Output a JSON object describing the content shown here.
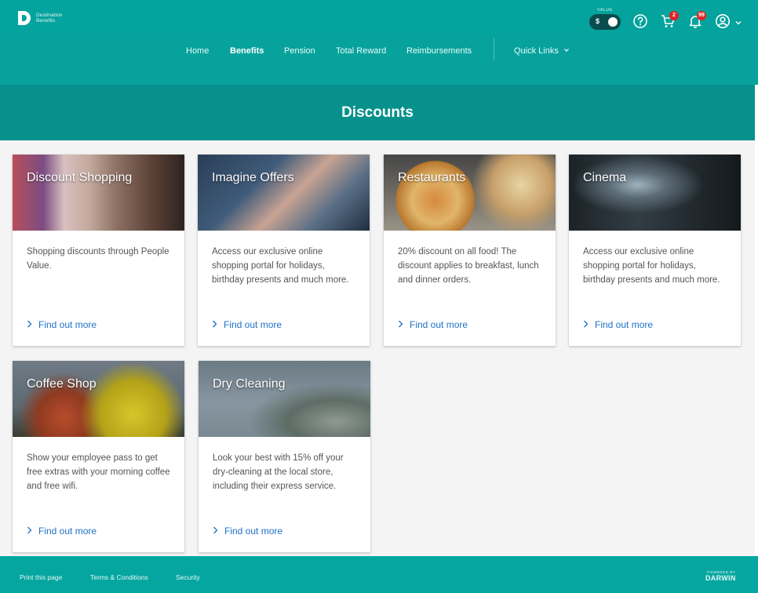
{
  "header": {
    "logo_line1": "Destination",
    "logo_line2": "Benefits",
    "value_label": "VALUE",
    "value_toggle_symbol": "$",
    "cart_count": "2",
    "notification_count": "99",
    "icons": [
      "help-icon",
      "cart-icon",
      "bell-icon",
      "user-icon",
      "chevron-down-icon"
    ]
  },
  "nav": {
    "items": [
      {
        "label": "Home"
      },
      {
        "label": "Benefits"
      },
      {
        "label": "Pension"
      },
      {
        "label": "Total Reward"
      },
      {
        "label": "Reimbursements"
      },
      {
        "label": "Quick Links"
      }
    ],
    "active": "Benefits"
  },
  "banner": {
    "title": "Discounts"
  },
  "cards": [
    {
      "title": "Discount Shopping",
      "description": "Shopping discounts through People Value.",
      "link": "Find out more"
    },
    {
      "title": "Imagine Offers",
      "description": "Access our exclusive online shopping portal for holidays, birthday presents and much more.",
      "link": "Find out more"
    },
    {
      "title": "Restaurants",
      "description": "20% discount on all food! The discount applies to breakfast, lunch and dinner orders.",
      "link": "Find out more"
    },
    {
      "title": "Cinema",
      "description": "Access our exclusive online shopping portal for holidays, birthday presents and much more.",
      "link": "Find out more"
    },
    {
      "title": "Coffee Shop",
      "description": "Show your employee pass to get free extras with your morning coffee and free wifi.",
      "link": "Find out more"
    },
    {
      "title": "Dry Cleaning",
      "description": "Look your best with 15% off your dry-cleaning at the local store, including their express service.",
      "link": "Find out more"
    }
  ],
  "footer": {
    "links": [
      {
        "label": "Print this page"
      },
      {
        "label": "Terms & Conditions"
      },
      {
        "label": "Security"
      }
    ],
    "powered_by": "POWERED BY",
    "brand": "DARWIN"
  },
  "colors": {
    "header": "#04a39d",
    "nav": "#07a29c",
    "banner": "#06918c",
    "link": "#1e72c8",
    "badge": "#e02424"
  }
}
